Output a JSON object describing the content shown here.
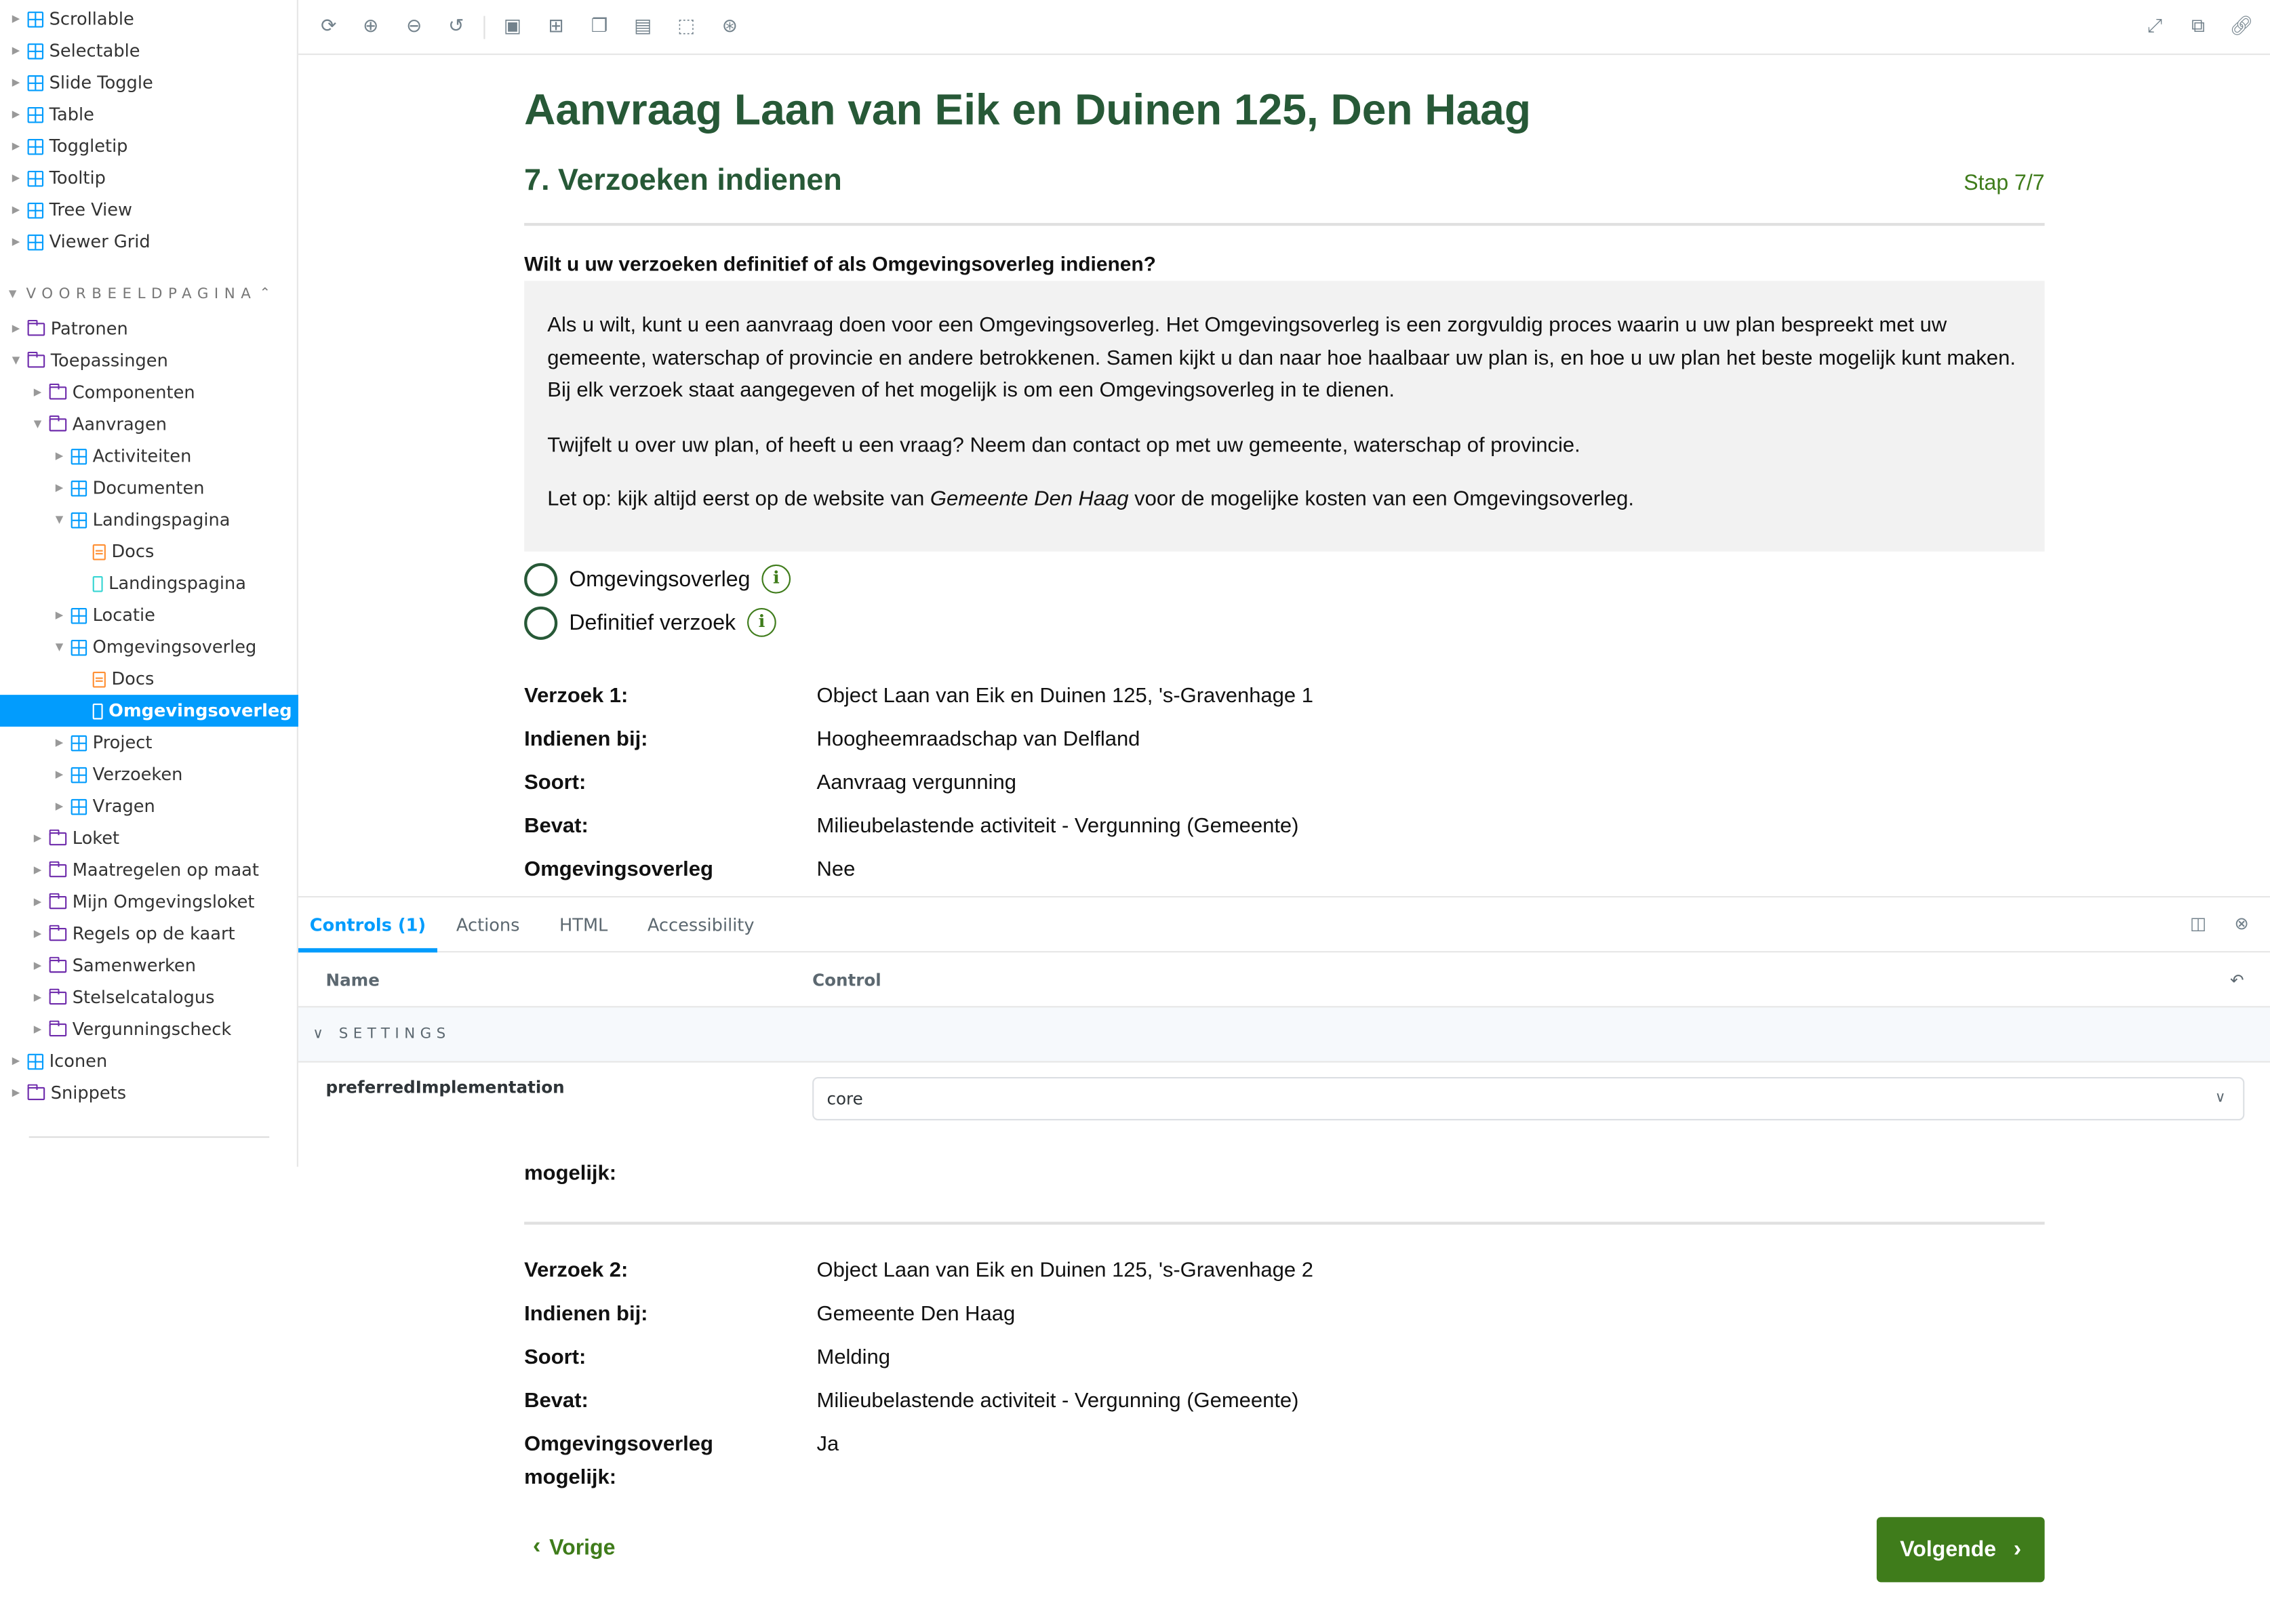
{
  "sidebar": {
    "items_top": [
      {
        "label": "Scrollable",
        "icon": "component-icon"
      },
      {
        "label": "Selectable",
        "icon": "component-icon"
      },
      {
        "label": "Slide Toggle",
        "icon": "component-icon"
      },
      {
        "label": "Table",
        "icon": "component-icon"
      },
      {
        "label": "Toggletip",
        "icon": "component-icon"
      },
      {
        "label": "Tooltip",
        "icon": "component-icon"
      },
      {
        "label": "Tree View",
        "icon": "component-icon"
      },
      {
        "label": "Viewer Grid",
        "icon": "component-icon"
      }
    ],
    "section_title": "VOORBEELDPAGINA",
    "items": [
      {
        "label": "Patronen",
        "icon": "folder-icon"
      },
      {
        "label": "Toepassingen",
        "icon": "folder-icon"
      },
      {
        "label": "Componenten",
        "icon": "folder-icon"
      },
      {
        "label": "Aanvragen",
        "icon": "folder-icon"
      },
      {
        "label": "Activiteiten",
        "icon": "component-icon"
      },
      {
        "label": "Documenten",
        "icon": "component-icon"
      },
      {
        "label": "Landingspagina",
        "icon": "component-icon"
      },
      {
        "label": "Docs",
        "icon": "doc-icon"
      },
      {
        "label": "Landingspagina",
        "icon": "story-icon"
      },
      {
        "label": "Locatie",
        "icon": "component-icon"
      },
      {
        "label": "Omgevingsoverleg",
        "icon": "component-icon"
      },
      {
        "label": "Docs",
        "icon": "doc-icon"
      },
      {
        "label": "Omgevingsoverleg",
        "icon": "story-icon",
        "selected": true
      },
      {
        "label": "Project",
        "icon": "component-icon"
      },
      {
        "label": "Verzoeken",
        "icon": "component-icon"
      },
      {
        "label": "Vragen",
        "icon": "component-icon"
      },
      {
        "label": "Loket",
        "icon": "folder-icon"
      },
      {
        "label": "Maatregelen op maat",
        "icon": "folder-icon"
      },
      {
        "label": "Mijn Omgevingsloket",
        "icon": "folder-icon"
      },
      {
        "label": "Regels op de kaart",
        "icon": "folder-icon"
      },
      {
        "label": "Samenwerken",
        "icon": "folder-icon"
      },
      {
        "label": "Stelselcatalogus",
        "icon": "folder-icon"
      },
      {
        "label": "Vergunningscheck",
        "icon": "folder-icon"
      },
      {
        "label": "Iconen",
        "icon": "component-icon"
      },
      {
        "label": "Snippets",
        "icon": "folder-icon"
      }
    ]
  },
  "toolbar": {
    "icons": [
      "reload-icon",
      "zoom-in-icon",
      "zoom-out-icon",
      "zoom-reset-icon",
      "background-icon",
      "grid-icon",
      "viewport-icon",
      "measure-icon",
      "outline-icon",
      "accessibility-icon"
    ],
    "right_icons": [
      "fullscreen-icon",
      "open-new-tab-icon",
      "copy-link-icon"
    ]
  },
  "preview": {
    "title": "Aanvraag Laan van Eik en Duinen 125, Den Haag",
    "subtitle": "7. Verzoeken indienen",
    "step": "Stap 7/7",
    "question": "Wilt u uw verzoeken definitief of als Omgevingsoverleg indienen?",
    "info_p1": "Als u wilt, kunt u een aanvraag doen voor een Omgevingsoverleg. Het Omgevingsoverleg is een zorgvuldig proces waarin u uw plan bespreekt met uw gemeente, waterschap of provincie en andere betrokkenen. Samen kijkt u dan naar hoe haalbaar uw plan is, en hoe u uw plan het beste mogelijk kunt maken. Bij elk verzoek staat aangegeven of het mogelijk is om een Omgevingsoverleg in te dienen.",
    "info_p2": "Twijfelt u over uw plan, of heeft u een vraag? Neem dan contact op met uw gemeente, waterschap of provincie.",
    "info_p3_pre": "Let op: kijk altijd eerst op de website van ",
    "info_p3_em": "Gemeente Den Haag",
    "info_p3_post": " voor de mogelijke kosten van een Omgevingsoverleg.",
    "radio_1": "Omgevingsoverleg",
    "radio_2": "Definitief verzoek",
    "request_1": [
      {
        "label": "Verzoek 1:",
        "value": "Object Laan van Eik en Duinen 125, 's-Gravenhage 1"
      },
      {
        "label": "Indienen bij:",
        "value": "Hoogheemraadschap van Delfland"
      },
      {
        "label": "Soort:",
        "value": "Aanvraag vergunning"
      },
      {
        "label": "Bevat:",
        "value": "Milieubelastende activiteit - Vergunning (Gemeente)"
      },
      {
        "label": "Omgevingsoverleg",
        "value": "Nee"
      }
    ],
    "request_1_label_tail": "mogelijk:",
    "request_2": [
      {
        "label": "Verzoek 2:",
        "value": "Object Laan van Eik en Duinen 125, 's-Gravenhage 2"
      },
      {
        "label": "Indienen bij:",
        "value": "Gemeente Den Haag"
      },
      {
        "label": "Soort:",
        "value": "Melding"
      },
      {
        "label": "Bevat:",
        "value": "Milieubelastende activiteit - Vergunning (Gemeente)"
      }
    ],
    "request_2_last_label_1": "Omgevingsoverleg",
    "request_2_last_label_2": "mogelijk:",
    "request_2_last_value": "Ja",
    "prev_label": "Vorige",
    "next_label": "Volgende"
  },
  "panel": {
    "tabs": [
      "Controls (1)",
      "Actions",
      "HTML",
      "Accessibility"
    ],
    "active_tab": "Controls (1)",
    "col_name": "Name",
    "col_control": "Control",
    "section": "SETTINGS",
    "prop_name": "preferredImplementation",
    "prop_value": "core"
  },
  "colors": {
    "accent": "#029cfd",
    "heading_green": "#275937",
    "button_green": "#3f7c1b",
    "info_bg": "#f2f2f2"
  }
}
